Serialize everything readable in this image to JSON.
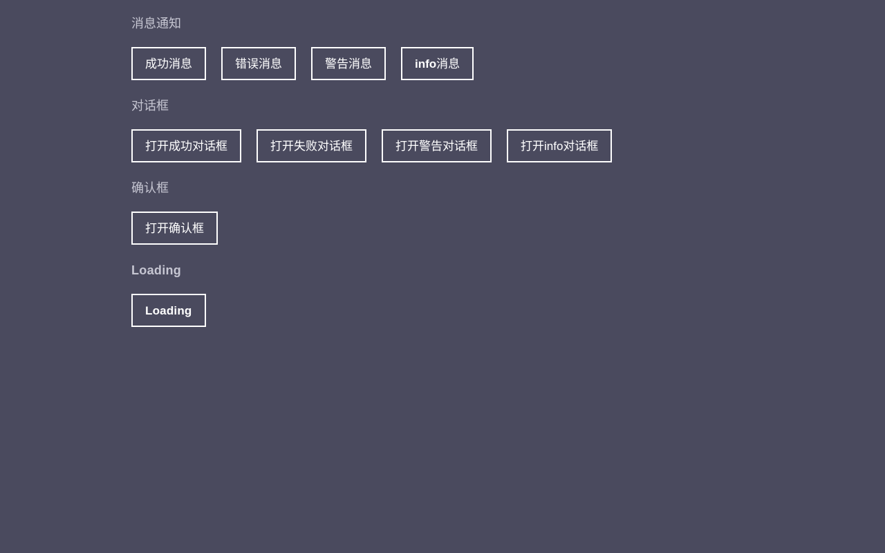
{
  "sections": [
    {
      "id": "message",
      "title": "消息通知",
      "title_is_latin": false,
      "buttons": [
        {
          "label": "成功消息",
          "name": "success-message-button",
          "latin_prefix": "",
          "cjk_suffix": "成功消息"
        },
        {
          "label": "错误消息",
          "name": "error-message-button",
          "latin_prefix": "",
          "cjk_suffix": "错误消息"
        },
        {
          "label": "警告消息",
          "name": "warning-message-button",
          "latin_prefix": "",
          "cjk_suffix": "警告消息"
        },
        {
          "label": "info消息",
          "name": "info-message-button",
          "latin_prefix": "info",
          "cjk_suffix": "消息"
        }
      ]
    },
    {
      "id": "dialog",
      "title": "对话框",
      "title_is_latin": false,
      "buttons": [
        {
          "label": "打开成功对话框",
          "name": "open-success-dialog-button",
          "latin_prefix": "",
          "cjk_suffix": "打开成功对话框"
        },
        {
          "label": "打开失败对话框",
          "name": "open-failure-dialog-button",
          "latin_prefix": "",
          "cjk_suffix": "打开失败对话框"
        },
        {
          "label": "打开警告对话框",
          "name": "open-warning-dialog-button",
          "latin_prefix": "",
          "cjk_suffix": "打开警告对话框"
        },
        {
          "label": "打开info对话框",
          "name": "open-info-dialog-button",
          "latin_prefix": "",
          "cjk_suffix": "打开info对话框"
        }
      ]
    },
    {
      "id": "confirm",
      "title": "确认框",
      "title_is_latin": false,
      "buttons": [
        {
          "label": "打开确认框",
          "name": "open-confirm-dialog-button",
          "latin_prefix": "",
          "cjk_suffix": "打开确认框"
        }
      ]
    },
    {
      "id": "loading",
      "title": "Loading",
      "title_is_latin": true,
      "buttons": [
        {
          "label": "Loading",
          "name": "loading-button",
          "latin_prefix": "Loading",
          "cjk_suffix": ""
        }
      ]
    }
  ],
  "theme": {
    "background": "#4a4a5e",
    "heading_color": "#c6c6d2",
    "button_border": "#ffffff",
    "button_text": "#ffffff"
  }
}
